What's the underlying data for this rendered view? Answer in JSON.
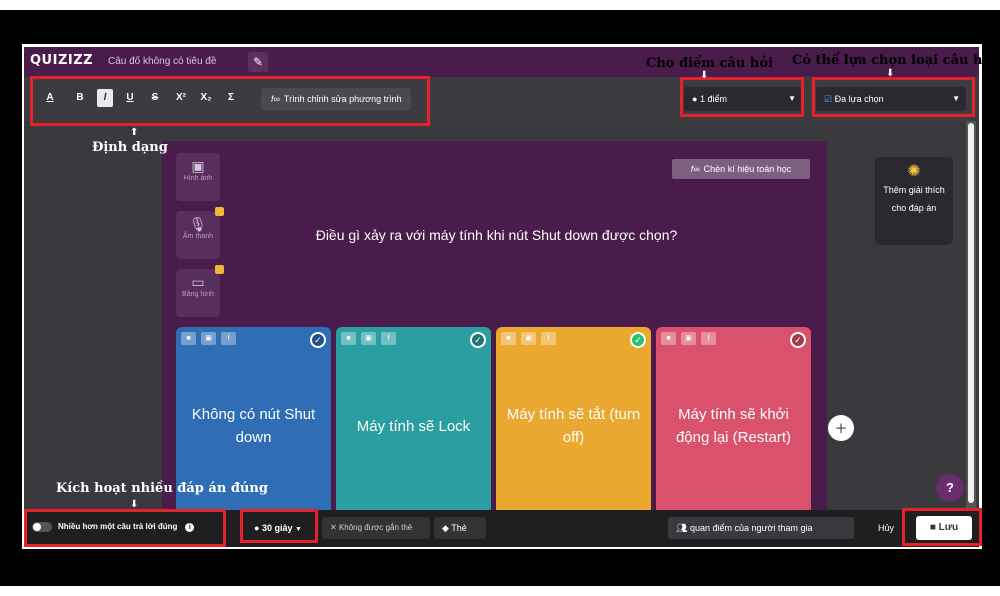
{
  "app": {
    "logo": "QUIZIZZ",
    "quiz_title": "Câu đố không có tiêu đề",
    "edit_icon": "pencil-icon"
  },
  "toolbar": {
    "buttons": [
      {
        "label": "A",
        "name": "text-color-button"
      },
      {
        "label": "B",
        "name": "bold-button"
      },
      {
        "label": "I",
        "name": "italic-button"
      },
      {
        "label": "U",
        "name": "underline-button"
      },
      {
        "label": "S",
        "name": "strikethrough-button"
      },
      {
        "label": "X²",
        "name": "superscript-button"
      },
      {
        "label": "X₂",
        "name": "subscript-button"
      },
      {
        "label": "Σ",
        "name": "sigma-button"
      }
    ],
    "equation_editor_label": "Trình chỉnh sửa phương trình",
    "points_value": "1 điểm",
    "question_type_value": "Đa lựa chọn"
  },
  "editor": {
    "math_symbols_label": "Chèn kí hiệu toán học",
    "question": "Điều gì xảy ra với máy tính khi nút Shut down được chọn?",
    "media": [
      {
        "label": "Hình ảnh",
        "icon": "image-icon"
      },
      {
        "label": "Âm thanh",
        "icon": "microphone-icon"
      },
      {
        "label": "Băng hình",
        "icon": "video-icon"
      }
    ],
    "answers": [
      {
        "text": "Không có nút Shut down",
        "color": "#2f6db5",
        "correct": false
      },
      {
        "text": "Máy tính sẽ Lock",
        "color": "#2a9ea0",
        "correct": false
      },
      {
        "text": "Máy tính sẽ tắt (turn off)",
        "color": "#eaa830",
        "correct": true
      },
      {
        "text": "Máy tính sẽ khởi động lại (Restart)",
        "color": "#d9516a",
        "correct": false
      }
    ],
    "explanation_label": "Thêm giải thích cho đáp án",
    "help_label": "?"
  },
  "bottom": {
    "multi_answer_label": "Nhiều hơn một câu trả lời đúng",
    "time_value": "30 giây",
    "topic_label": "Không được gắn thẻ",
    "tag_label": "Thẻ",
    "participants_label": "quan điểm của người tham gia",
    "cancel_label": "Hủy",
    "save_label": "Lưu"
  },
  "annotations": {
    "format": "Định dạng",
    "points": "Cho điểm câu hỏi",
    "question_type": "Có thể lựa chọn loại câu hỏi",
    "multi_answer": "Kích hoạt nhiều đáp án đúng"
  },
  "colors": {
    "brand_purple": "#4a1c4b",
    "highlight_red": "#e5222b"
  }
}
